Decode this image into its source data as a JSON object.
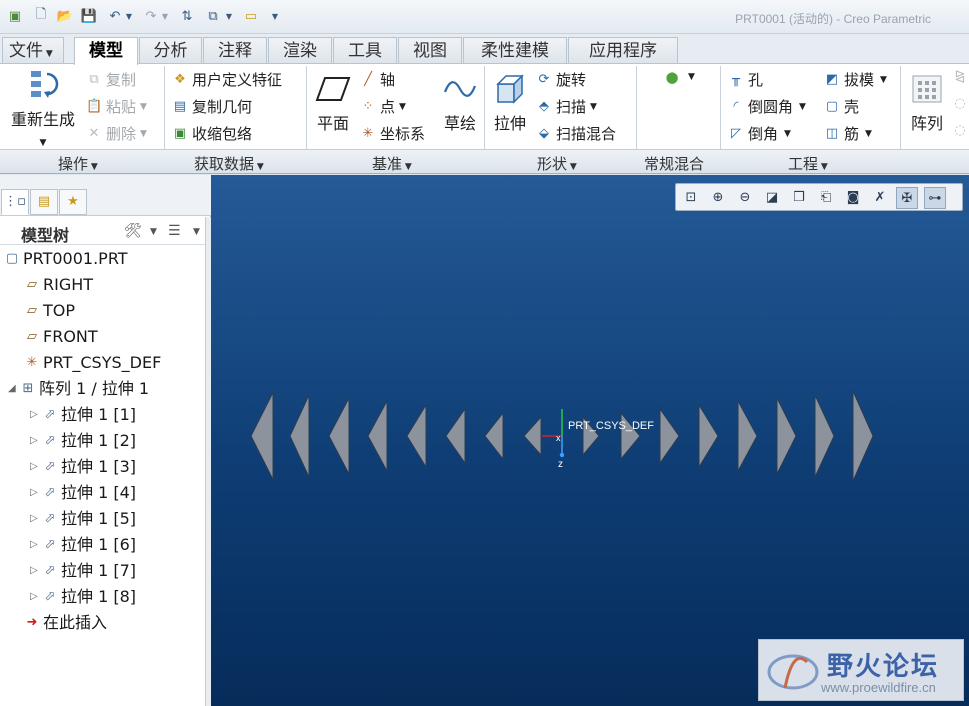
{
  "window": {
    "title": "PRT0001 (活动的) - Creo Parametric"
  },
  "tabs": [
    "文件",
    "模型",
    "分析",
    "注释",
    "渲染",
    "工具",
    "视图",
    "柔性建模",
    "应用程序"
  ],
  "ribbon": {
    "operations": {
      "regenerate": "重新生成",
      "copy": "复制",
      "paste": "粘贴",
      "delete": "删除",
      "group": "操作"
    },
    "getdata": {
      "udf": "用户定义特征",
      "copy_geom": "复制几何",
      "shrinkwrap": "收缩包络",
      "group": "获取数据"
    },
    "datum": {
      "plane": "平面",
      "axis": "轴",
      "point": "点",
      "csys": "坐标系",
      "sketch": "草绘",
      "group": "基准"
    },
    "shapes": {
      "extrude": "拉伸",
      "revolve": "旋转",
      "sweep": "扫描",
      "swept_blend": "扫描混合",
      "group": "形状"
    },
    "blend": {
      "group": "常规混合"
    },
    "engineering": {
      "hole": "孔",
      "round": "倒圆角",
      "chamfer": "倒角",
      "draft": "拔模",
      "shell": "壳",
      "rib": "筋",
      "group": "工程"
    },
    "pattern": {
      "label": "阵列"
    }
  },
  "model_tree": {
    "title": "模型树",
    "items": [
      {
        "label": "PRT0001.PRT",
        "icon": "part-icon"
      },
      {
        "label": "RIGHT",
        "icon": "datum-plane-icon"
      },
      {
        "label": "TOP",
        "icon": "datum-plane-icon"
      },
      {
        "label": "FRONT",
        "icon": "datum-plane-icon"
      },
      {
        "label": "PRT_CSYS_DEF",
        "icon": "csys-icon"
      },
      {
        "label": "阵列 1 / 拉伸 1",
        "icon": "pattern-icon"
      },
      {
        "label": "拉伸 1 [1]",
        "icon": "extrude-icon"
      },
      {
        "label": "拉伸 1 [2]",
        "icon": "extrude-icon"
      },
      {
        "label": "拉伸 1 [3]",
        "icon": "extrude-icon"
      },
      {
        "label": "拉伸 1 [4]",
        "icon": "extrude-icon"
      },
      {
        "label": "拉伸 1 [5]",
        "icon": "extrude-icon"
      },
      {
        "label": "拉伸 1 [6]",
        "icon": "extrude-icon"
      },
      {
        "label": "拉伸 1 [7]",
        "icon": "extrude-icon"
      },
      {
        "label": "拉伸 1 [8]",
        "icon": "extrude-icon"
      },
      {
        "label": "在此插入",
        "icon": "insert-here-icon"
      }
    ]
  },
  "viewport": {
    "csys_label": "PRT_CSYS_DEF",
    "axis_x": "x",
    "axis_z": "z",
    "background_top": "#245a97",
    "background_bottom": "#062c5a"
  },
  "watermark": {
    "cn": "野火论坛",
    "url": "www.proewildfire.cn"
  }
}
